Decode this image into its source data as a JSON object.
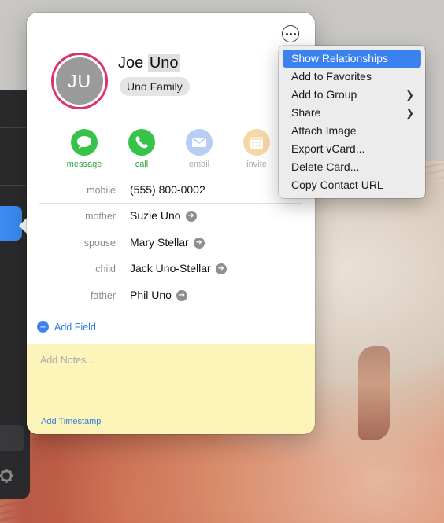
{
  "contact": {
    "initials": "JU",
    "first_name": "Joe",
    "last_name": "Uno",
    "group": "Uno Family"
  },
  "actions": [
    {
      "label": "message",
      "icon": "message-bubble-icon",
      "color": "#37c24a"
    },
    {
      "label": "call",
      "icon": "phone-icon",
      "color": "#37c24a"
    },
    {
      "label": "email",
      "icon": "envelope-icon",
      "color": "#b7cdf3"
    },
    {
      "label": "invite",
      "icon": "calendar-icon",
      "color": "#f6d7a6"
    }
  ],
  "fields": [
    {
      "label": "mobile",
      "value": "(555) 800-0002"
    },
    {
      "label": "mother",
      "value": "Suzie Uno"
    },
    {
      "label": "spouse",
      "value": "Mary Stellar"
    },
    {
      "label": "child",
      "value": "Jack Uno-Stellar"
    },
    {
      "label": "father",
      "value": "Phil Uno"
    }
  ],
  "add_field_label": "Add Field",
  "notes_placeholder": "Add Notes...",
  "add_timestamp_label": "Add Timestamp",
  "menu": {
    "items": [
      {
        "label": "Show Relationships",
        "highlighted": true
      },
      {
        "label": "Add to Favorites"
      },
      {
        "label": "Add to Group",
        "submenu": true
      },
      {
        "label": "Share",
        "submenu": true
      },
      {
        "label": "Attach Image"
      },
      {
        "label": "Export vCard..."
      },
      {
        "label": "Delete Card..."
      },
      {
        "label": "Copy Contact URL"
      }
    ]
  },
  "colors": {
    "accent": "#3b82f0",
    "avatar_ring": "#e0306e",
    "notes_bg": "#fcf4b8"
  }
}
